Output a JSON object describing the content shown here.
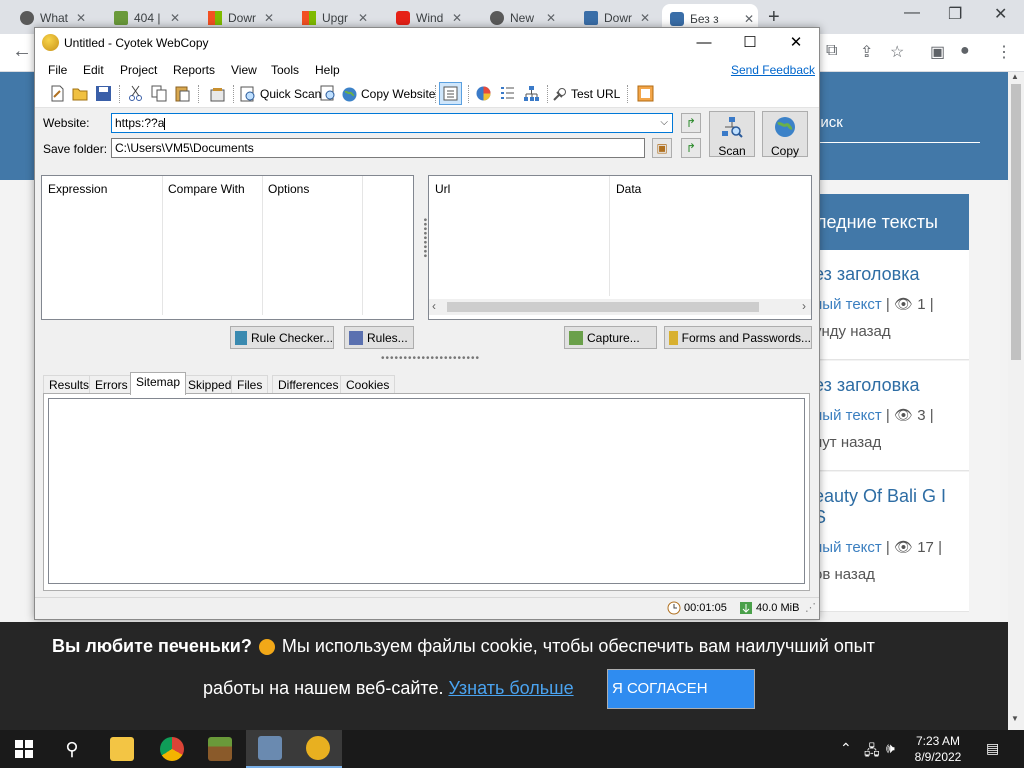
{
  "browser": {
    "tabs": [
      {
        "title": "What",
        "color": "#5a5a5a"
      },
      {
        "title": "404 |",
        "color": "#6a9a3a"
      },
      {
        "title": "Dowr",
        "color": "#e8531f"
      },
      {
        "title": "Upgr",
        "color": "#e8531f"
      },
      {
        "title": "Wind",
        "color": "#e62117"
      },
      {
        "title": "New",
        "color": "#5a5a5a"
      },
      {
        "title": "Dowr",
        "color": "#3a6ea8"
      },
      {
        "title": "Без з",
        "color": "#3a6ea8"
      }
    ],
    "new_tab": "+",
    "window_controls": {
      "minimize": "—",
      "maximize": "❐",
      "close": "✕"
    }
  },
  "website": {
    "search_text": "риск",
    "sidebar_heading": "ледние тексты",
    "cards": [
      {
        "title": "ез заголовка",
        "category": "ный текст",
        "views": "1",
        "time": "унду назад"
      },
      {
        "title": "ез заголовка",
        "category": "ный текст",
        "views": "3",
        "time": "нут назад"
      },
      {
        "title": "eauty Of Bali G I S",
        "category": "ный текст",
        "views": "17",
        "time": "ов назад"
      }
    ]
  },
  "cookie": {
    "bold": "Вы любите печеньки?",
    "text1": "Мы используем файлы cookie, чтобы обеспечить вам наилучший опыт",
    "text2": "работы на нашем веб-сайте.",
    "link": "Узнать больше",
    "button": "Я СОГЛАСЕН"
  },
  "app": {
    "title": "Untitled - Cyotek WebCopy",
    "menu": [
      "File",
      "Edit",
      "Project",
      "Reports",
      "View",
      "Tools",
      "Help"
    ],
    "send_feedback": "Send Feedback",
    "toolbar": {
      "quick_scan": "Quick Scan",
      "copy_website": "Copy Website",
      "test_url": "Test URL"
    },
    "website_label": "Website:",
    "website_value": "https:??a",
    "save_folder_label": "Save folder:",
    "save_folder_value": "C:\\Users\\VM5\\Documents",
    "scan_button": "Scan",
    "copy_button": "Copy",
    "rules_columns": [
      "Expression",
      "Compare With",
      "Options"
    ],
    "headers_columns": [
      "Url",
      "Data"
    ],
    "rule_checker_button": "Rule Checker...",
    "rules_button": "Rules...",
    "capture_button": "Capture...",
    "forms_button": "Forms and Passwords...",
    "tabs": [
      "Results",
      "Errors",
      "Sitemap",
      "Skipped",
      "Files",
      "Differences",
      "Cookies"
    ],
    "active_tab": "Sitemap",
    "status_time": "00:01:05",
    "status_size": "40.0 MiB"
  },
  "taskbar": {
    "time": "7:23 AM",
    "date": "8/9/2022"
  }
}
